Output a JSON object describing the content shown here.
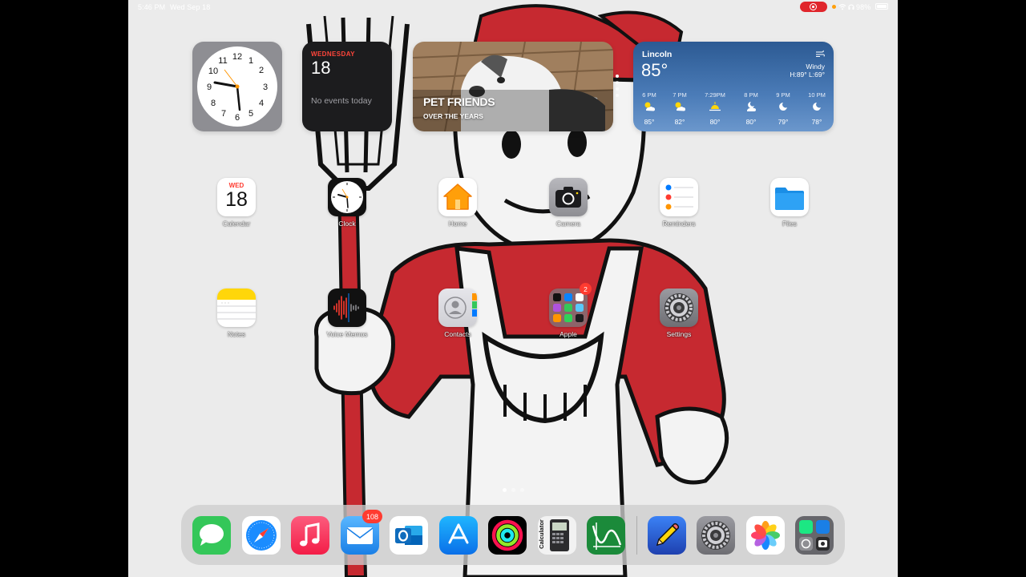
{
  "status_bar": {
    "time": "5:46 PM",
    "date": "Wed Sep 18",
    "battery": "98%"
  },
  "widgets": {
    "calendar": {
      "weekday": "WEDNESDAY",
      "day": "18",
      "events": "No events today"
    },
    "photos": {
      "title": "PET FRIENDS",
      "subtitle": "OVER THE YEARS"
    },
    "weather": {
      "city": "Lincoln",
      "temp": "85°",
      "condition": "Windy",
      "hilo": "H:89° L:69°",
      "hours": [
        {
          "time": "6 PM",
          "icon": "sun-cloud-icon",
          "temp": "85°"
        },
        {
          "time": "7 PM",
          "icon": "sun-cloud-icon",
          "temp": "82°"
        },
        {
          "time": "7:29PM",
          "icon": "sunset-icon",
          "temp": "80°"
        },
        {
          "time": "8 PM",
          "icon": "moon-cloud-icon",
          "temp": "80°"
        },
        {
          "time": "9 PM",
          "icon": "moon-icon",
          "temp": "79°"
        },
        {
          "time": "10 PM",
          "icon": "moon-icon",
          "temp": "78°"
        }
      ]
    }
  },
  "apps": {
    "calendar": {
      "label": "Calendar",
      "weekday": "WED",
      "day": "18"
    },
    "clock": {
      "label": "Clock"
    },
    "home": {
      "label": "Home"
    },
    "camera": {
      "label": "Camera"
    },
    "reminders": {
      "label": "Reminders"
    },
    "files": {
      "label": "Files"
    },
    "notes": {
      "label": "Notes"
    },
    "voice_memos": {
      "label": "Voice Memos"
    },
    "contacts": {
      "label": "Contacts"
    },
    "apple_folder": {
      "label": "Apple",
      "badge": "2"
    },
    "settings": {
      "label": "Settings"
    }
  },
  "dock": {
    "mail_badge": "108",
    "calculator_text": "Calculator"
  },
  "colors": {
    "badge": "#ff3b30",
    "calendar_red": "#ff3b30",
    "weather_blue": "#2c5a93",
    "screen_record": "#e0252b"
  }
}
